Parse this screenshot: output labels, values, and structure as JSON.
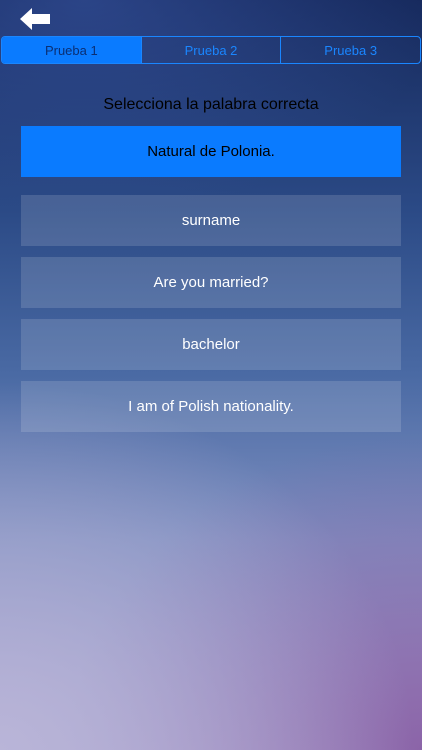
{
  "header": {
    "back_icon": "back-arrow-icon"
  },
  "tabs": [
    {
      "label": "Prueba 1",
      "active": true
    },
    {
      "label": "Prueba 2",
      "active": false
    },
    {
      "label": "Prueba 3",
      "active": false
    }
  ],
  "quiz": {
    "instruction": "Selecciona la palabra correcta",
    "prompt": "Natural de Polonia.",
    "options": [
      {
        "label": "surname"
      },
      {
        "label": "Are you married?"
      },
      {
        "label": "bachelor"
      },
      {
        "label": "I am of Polish nationality."
      }
    ]
  },
  "colors": {
    "accent": "#0a7bff",
    "tab_border": "#1a86ff"
  }
}
